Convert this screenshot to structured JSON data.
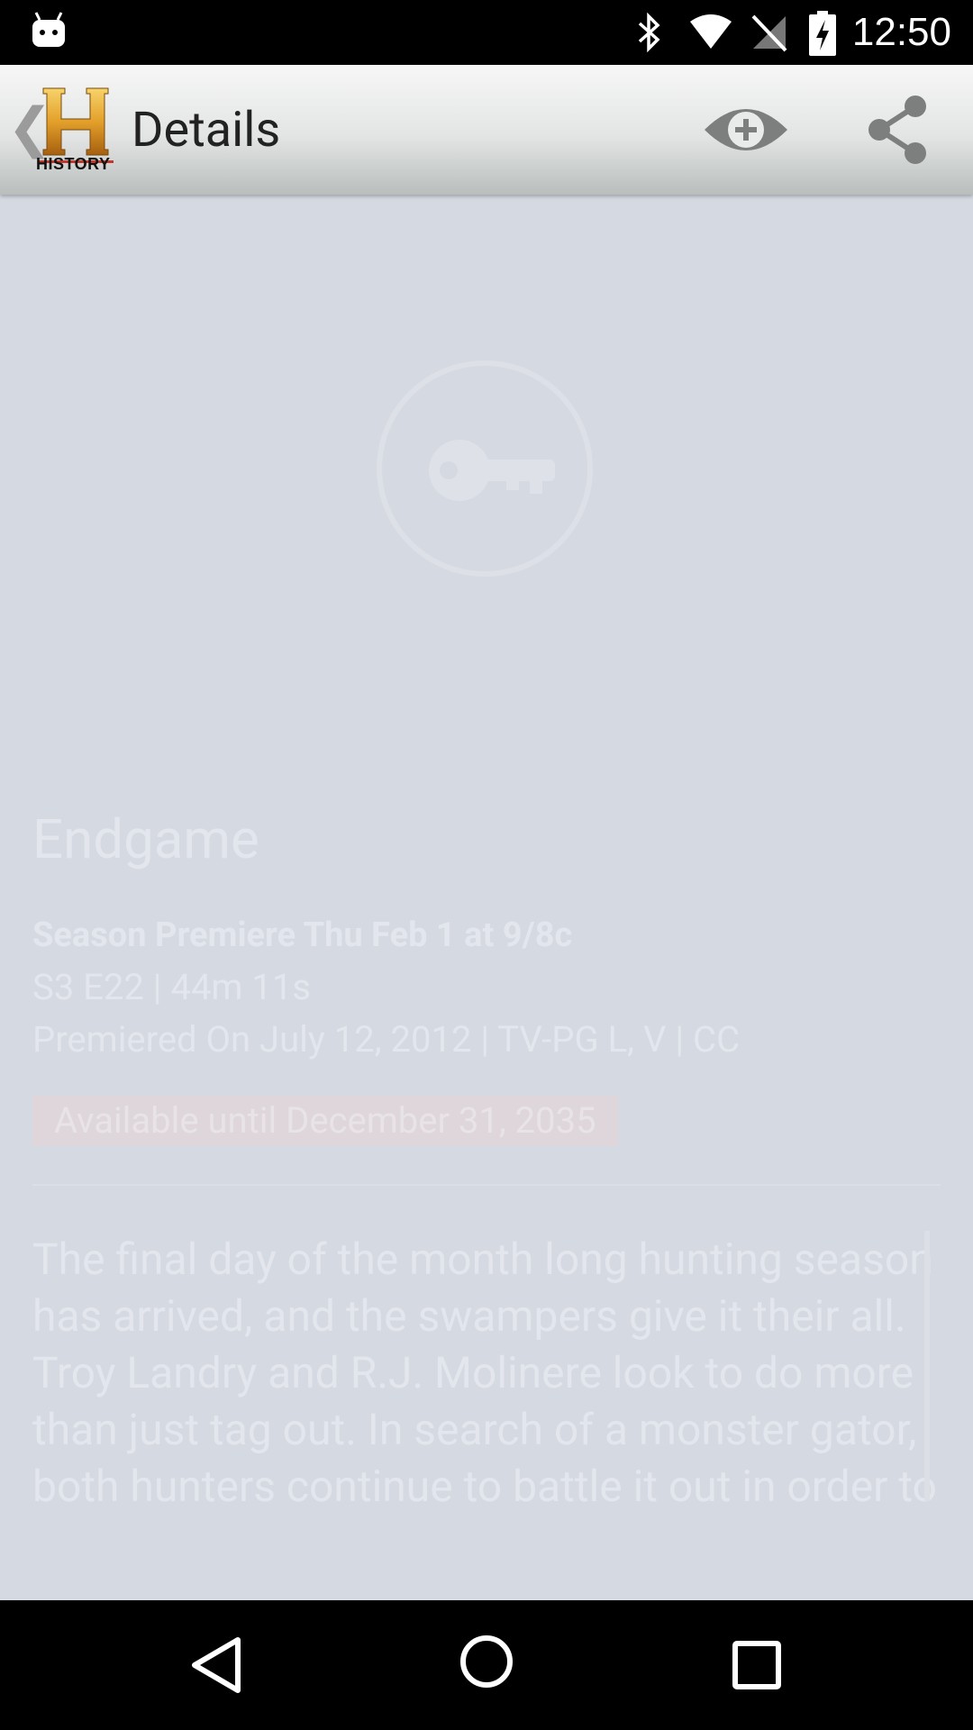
{
  "status_bar": {
    "time": "12:50",
    "icons": [
      "android-icon",
      "bluetooth-icon",
      "wifi-icon",
      "signal-off-icon",
      "battery-charging-icon"
    ]
  },
  "action_bar": {
    "title": "Details",
    "logo_text": "HISTORY",
    "back_glyph": "❮",
    "actions": [
      "watchlist-add-icon",
      "share-icon"
    ]
  },
  "episode": {
    "title": "Endgame",
    "premiere": "Season Premiere Thu Feb 1 at 9/8c",
    "meta_line1": "S3 E22  | 44m 11s",
    "meta_line2": "Premiered On July 12, 2012  |  TV-PG L, V  |  CC",
    "availability": "Available until December 31, 2035",
    "description": "The final day of the month long hunting season has arrived, and the swampers give it their all. Troy Landry and R.J. Molinere look to do more than just tag out. In search of a monster gator, both hunters continue to battle it out in order to"
  },
  "colors": {
    "background": "#d5d9e1",
    "faded_text": "#e3e6ec",
    "logo_gold": "#e3a02a"
  }
}
